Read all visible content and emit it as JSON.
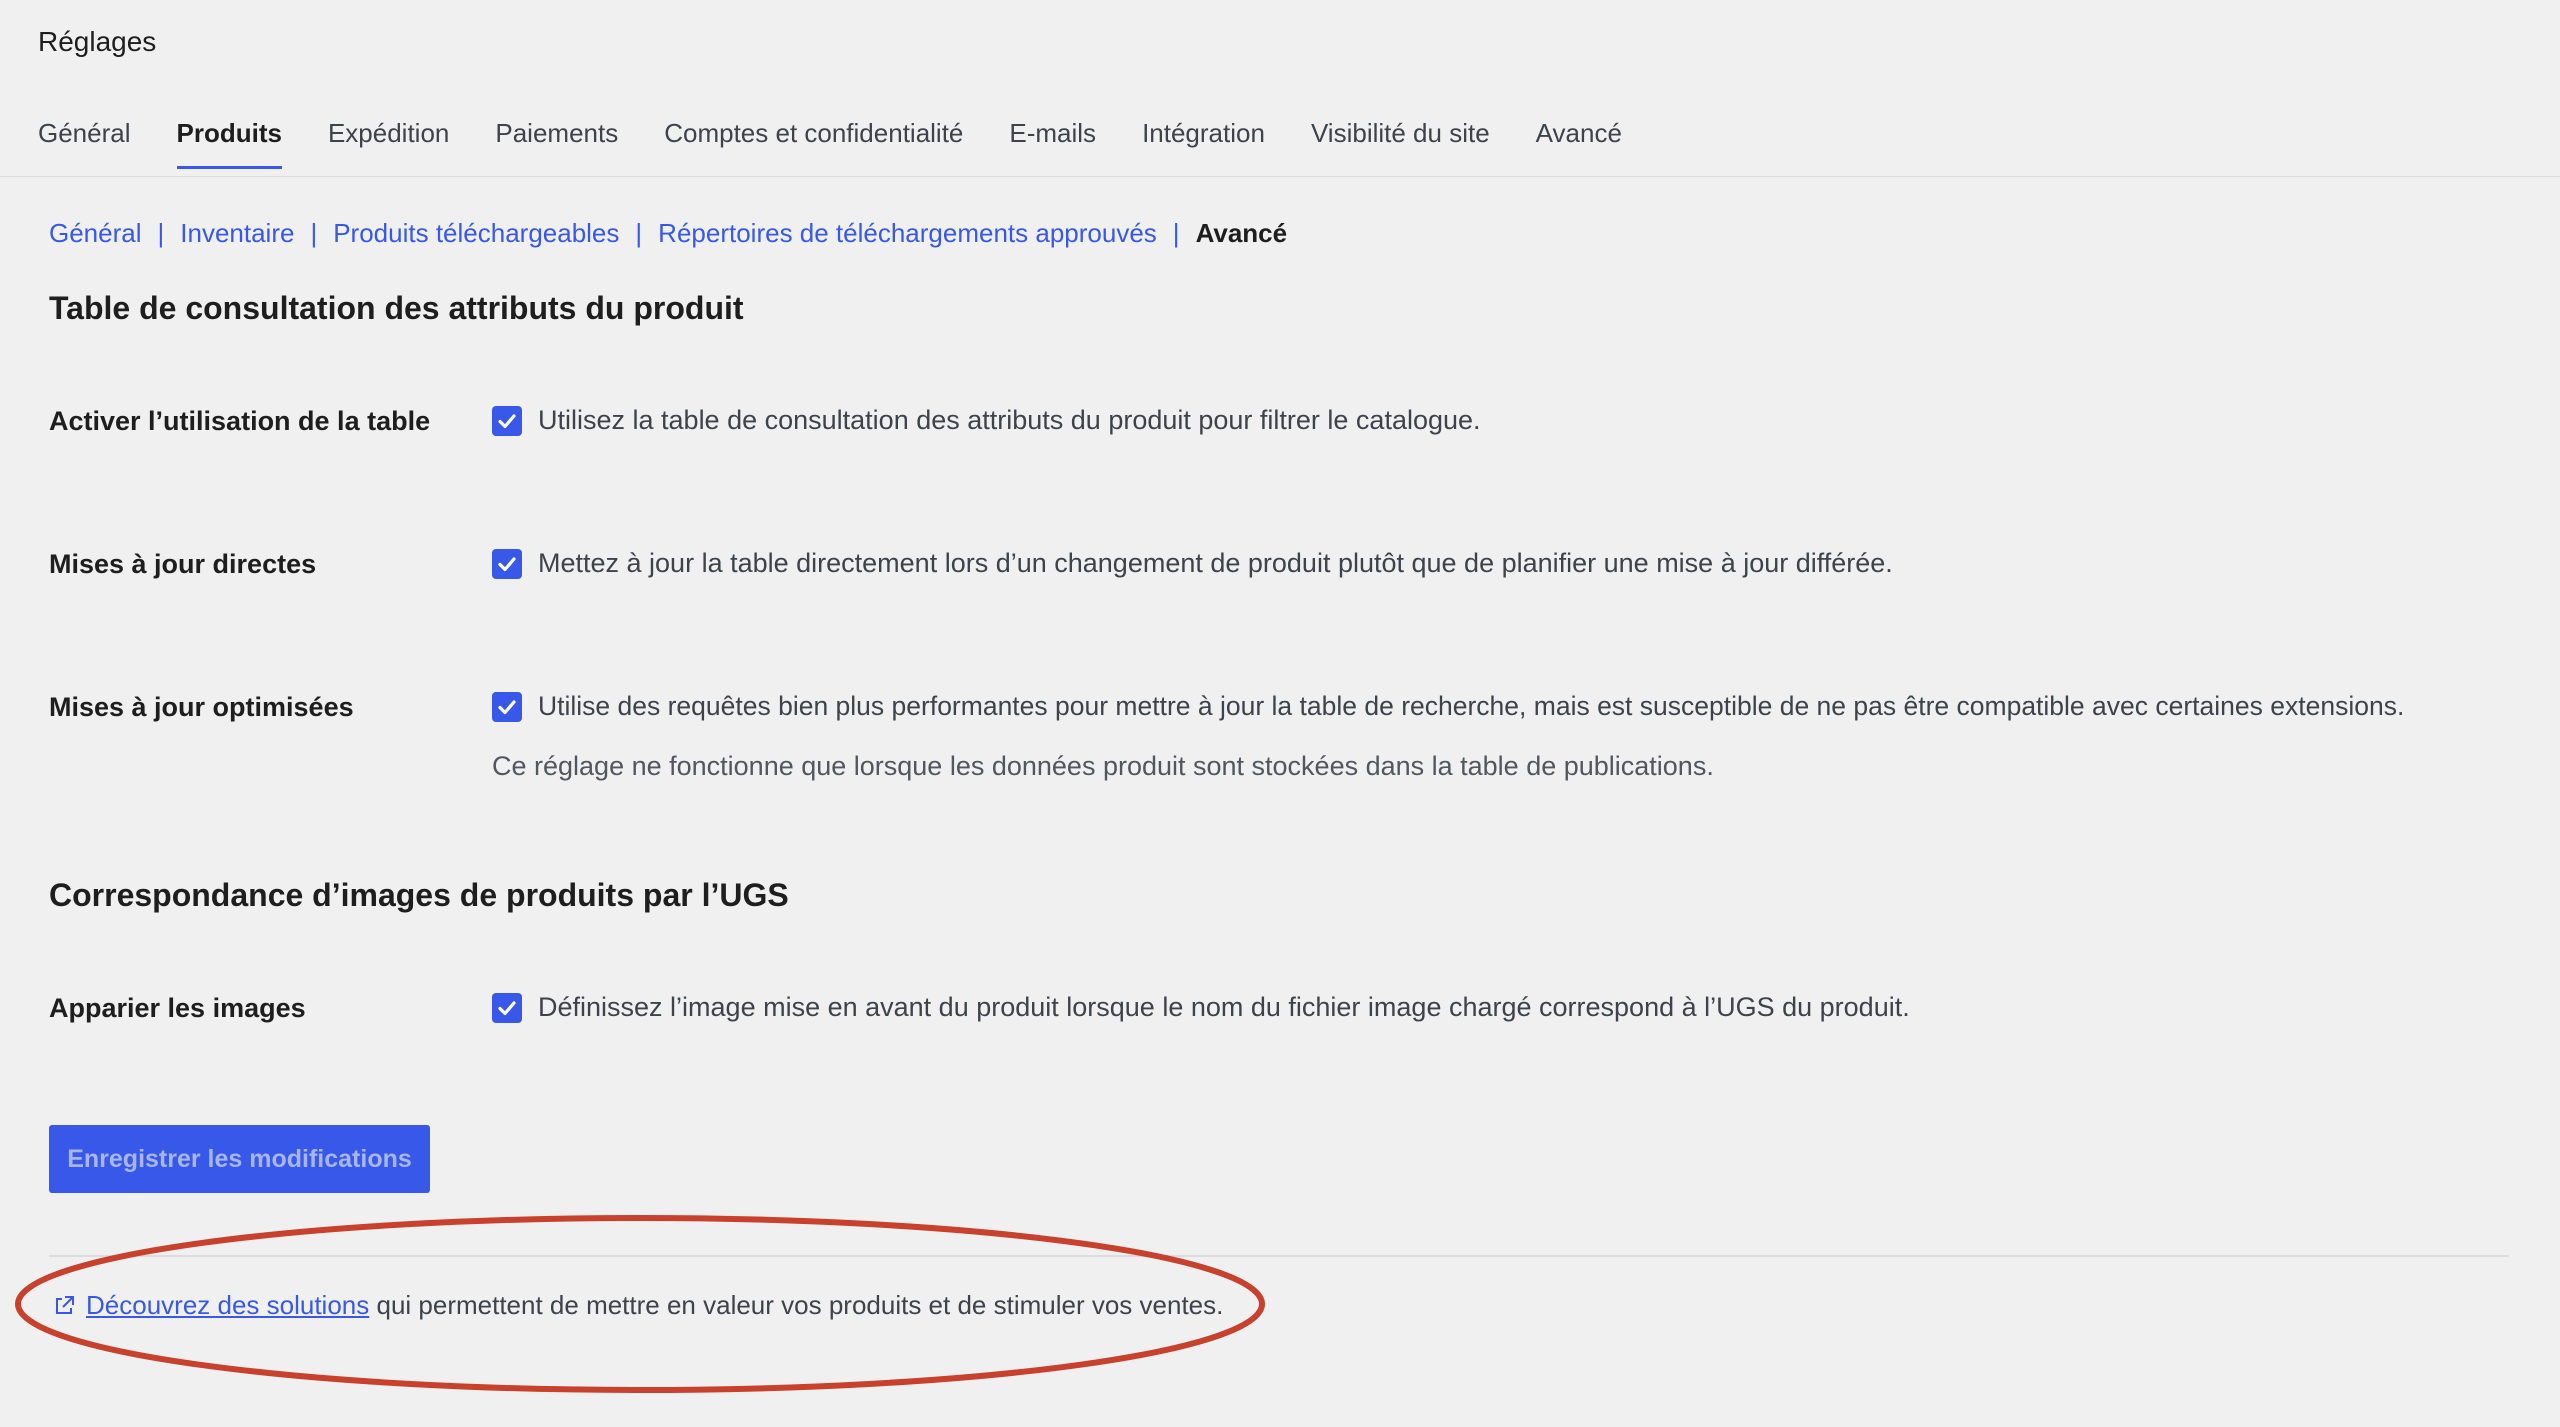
{
  "header": {
    "title": "Réglages"
  },
  "tabs": [
    {
      "label": "Général",
      "active": false
    },
    {
      "label": "Produits",
      "active": true
    },
    {
      "label": "Expédition",
      "active": false
    },
    {
      "label": "Paiements",
      "active": false
    },
    {
      "label": "Comptes et confidentialité",
      "active": false
    },
    {
      "label": "E-mails",
      "active": false
    },
    {
      "label": "Intégration",
      "active": false
    },
    {
      "label": "Visibilité du site",
      "active": false
    },
    {
      "label": "Avancé",
      "active": false
    }
  ],
  "subnav": {
    "items": [
      "Général",
      "Inventaire",
      "Produits téléchargeables",
      "Répertoires de téléchargements approuvés"
    ],
    "separator": "|",
    "current": "Avancé"
  },
  "sections": {
    "lookup": {
      "title": "Table de consultation des attributs du produit",
      "rows": [
        {
          "label": "Activer l’utilisation de la table",
          "checked": true,
          "text": "Utilisez la table de consultation des attributs du produit pour filtrer le catalogue."
        },
        {
          "label": "Mises à jour directes",
          "checked": true,
          "text": "Mettez à jour la table directement lors d’un changement de produit plutôt que de planifier une mise à jour différée."
        },
        {
          "label": "Mises à jour optimisées",
          "checked": true,
          "text": "Utilise des requêtes bien plus performantes pour mettre à jour la table de recherche, mais est susceptible de ne pas être compatible avec certaines extensions.",
          "description": "Ce réglage ne fonctionne que lorsque les données produit sont stockées dans la table de publications."
        }
      ]
    },
    "images": {
      "title": "Correspondance d’images de produits par l’UGS",
      "rows": [
        {
          "label": "Apparier les images",
          "checked": true,
          "text": "Définissez l’image mise en avant du produit lorsque le nom du fichier image chargé correspond à l’UGS du produit."
        }
      ]
    }
  },
  "save_button": {
    "label": "Enregistrer les modifications"
  },
  "footer": {
    "icon": "external-link-icon",
    "link_text": "Découvrez des solutions",
    "rest_text": " qui permettent de mettre en valeur vos produits et de stimuler vos ventes."
  },
  "colors": {
    "accent": "#3858e9",
    "annotation": "#c8412c",
    "background": "#f0f0f1"
  }
}
